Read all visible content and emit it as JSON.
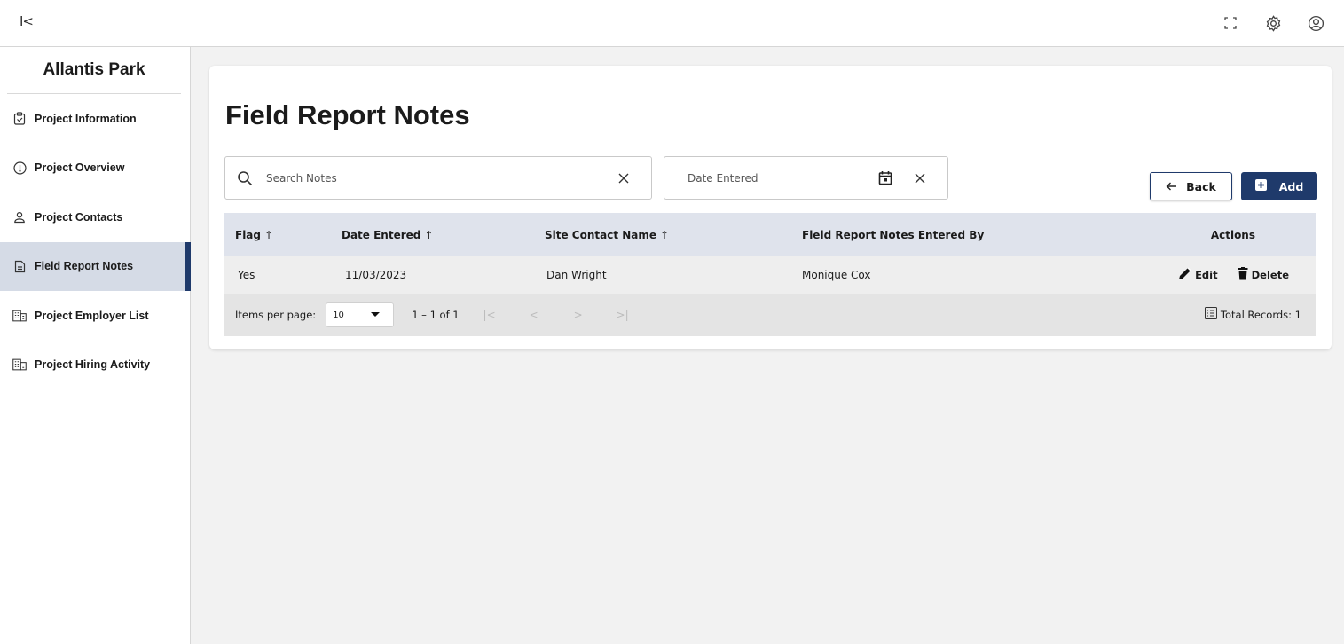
{
  "topbar": {
    "collapse_label": "I<",
    "icons": [
      "fullscreen-icon",
      "settings-icon",
      "account-icon"
    ]
  },
  "sidebar": {
    "project_name": "Allantis Park",
    "items": [
      {
        "label": "Project Information",
        "icon": "clipboard-check-icon",
        "active": false
      },
      {
        "label": "Project Overview",
        "icon": "alert-circle-icon",
        "active": false
      },
      {
        "label": "Project Contacts",
        "icon": "person-icon",
        "active": false
      },
      {
        "label": "Field Report Notes",
        "icon": "document-icon",
        "active": true
      },
      {
        "label": "Project Employer List",
        "icon": "building-icon",
        "active": false
      },
      {
        "label": "Project Hiring Activity",
        "icon": "building-icon",
        "active": false
      }
    ]
  },
  "main": {
    "title": "Field Report Notes",
    "search": {
      "placeholder": "Search Notes"
    },
    "date_filter": {
      "placeholder": "Date Entered"
    },
    "back_label": "Back",
    "add_label": "Add",
    "table": {
      "columns": [
        {
          "label": "Flag",
          "sortable": true
        },
        {
          "label": "Date Entered",
          "sortable": true
        },
        {
          "label": "Site Contact Name",
          "sortable": true
        },
        {
          "label": "Field Report Notes Entered By",
          "sortable": false
        },
        {
          "label": "Actions",
          "sortable": false
        }
      ],
      "sort_arrow": "↑",
      "rows": [
        {
          "flag": "Yes",
          "date_entered": "11/03/2023",
          "site_contact": "Dan Wright",
          "entered_by": "Monique Cox",
          "edit_label": "Edit",
          "delete_label": "Delete"
        }
      ]
    },
    "pager": {
      "items_per_page_label": "Items per page:",
      "items_per_page_value": "10",
      "range": "1 – 1 of 1",
      "first": "|<",
      "prev": "<",
      "next": ">",
      "last": ">|",
      "total_label": "Total Records: 1"
    }
  },
  "colors": {
    "primary": "#1f3a6b",
    "active_nav_bg": "#d5dbe6",
    "table_header_bg": "#dfe3ec"
  }
}
